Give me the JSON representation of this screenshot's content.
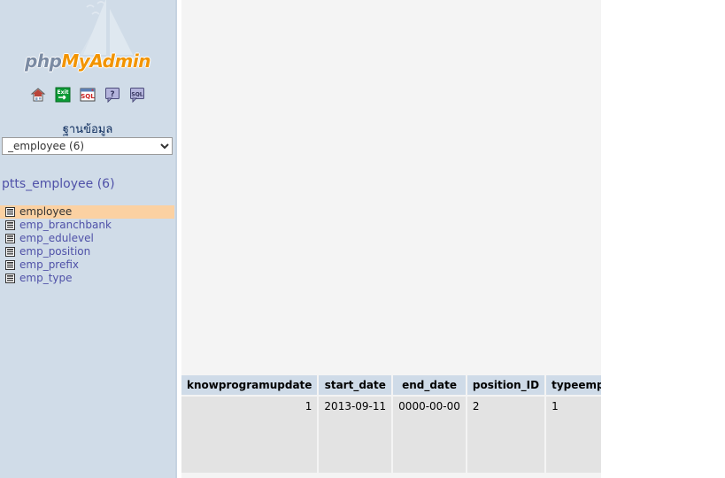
{
  "sidebar": {
    "logo": {
      "part1": "php",
      "part2": "MyAdmin",
      "boat_icon": "sailboat-watermark"
    },
    "icons": [
      {
        "name": "home-icon",
        "title": "Home"
      },
      {
        "name": "logout-icon",
        "title": "Log out"
      },
      {
        "name": "query-window-icon",
        "title": "SQL query window"
      },
      {
        "name": "help-icon",
        "title": "phpMyAdmin documentation"
      },
      {
        "name": "sql-help-icon",
        "title": "MySQL documentation"
      }
    ],
    "database_label": "ฐานข้อมูล",
    "database_select": {
      "value": "_employee (6)",
      "options": [
        "_employee (6)"
      ]
    },
    "database_heading": "ptts_employee (6)",
    "tables": [
      {
        "label": "employee",
        "selected": true,
        "icon": "table-icon"
      },
      {
        "label": "emp_branchbank",
        "selected": false,
        "icon": "table-icon"
      },
      {
        "label": "emp_edulevel",
        "selected": false,
        "icon": "table-icon"
      },
      {
        "label": "emp_position",
        "selected": false,
        "icon": "table-icon"
      },
      {
        "label": "emp_prefix",
        "selected": false,
        "icon": "table-icon"
      },
      {
        "label": "emp_type",
        "selected": false,
        "icon": "table-icon"
      }
    ]
  },
  "main": {
    "results": {
      "columns": [
        "knowprogramupdate",
        "start_date",
        "end_date",
        "position_ID",
        "typeemployee_ID"
      ],
      "rows": [
        {
          "knowprogramupdate": "1",
          "start_date": "2013-09-11",
          "end_date": "0000-00-00",
          "position_ID": "2",
          "typeemployee_ID": "1"
        }
      ]
    }
  },
  "colors": {
    "sidebar_bg": "#d0dce8",
    "selected_row": "#fbd1a2",
    "link": "#4f51a8",
    "header_bg": "#cfdbe8",
    "cell_bg": "#e3e3e3",
    "main_bg": "#f4f4f4",
    "logo_orange": "#f29400",
    "logo_gray": "#7b8ba3"
  }
}
